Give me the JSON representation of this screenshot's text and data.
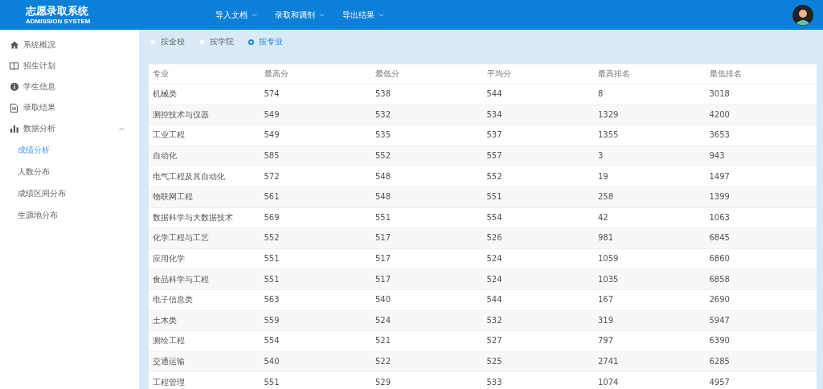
{
  "header": {
    "title": "志愿录取系统",
    "subtitle": "ADMISSION SYSTEM",
    "menu": [
      {
        "label": "导入文档"
      },
      {
        "label": "录取和调剂"
      },
      {
        "label": "导出结果"
      }
    ]
  },
  "sidebar": {
    "items": [
      {
        "label": "系统概况",
        "kind": "home",
        "selected": false
      },
      {
        "label": "招生计划",
        "kind": "book",
        "selected": false
      },
      {
        "label": "学生信息",
        "kind": "info",
        "selected": false
      },
      {
        "label": "录取结果",
        "kind": "doc",
        "selected": false
      },
      {
        "label": "数据分析",
        "kind": "chart",
        "selected": false,
        "expanded": true,
        "children": [
          {
            "label": "成绩分析",
            "selected": true
          },
          {
            "label": "人数分布",
            "selected": false
          },
          {
            "label": "成绩区间分布",
            "selected": false
          },
          {
            "label": "生源地分布",
            "selected": false
          }
        ]
      }
    ]
  },
  "filters": [
    {
      "label": "按全校",
      "selected": false
    },
    {
      "label": "按学院",
      "selected": false
    },
    {
      "label": "按专业",
      "selected": true
    }
  ],
  "table": {
    "columns": [
      "专业",
      "最高分",
      "最低分",
      "平均分",
      "最高排名",
      "最低排名"
    ],
    "rows": [
      [
        "机械类",
        "574",
        "538",
        "544",
        "8",
        "3018"
      ],
      [
        "测控技术与仪器",
        "549",
        "532",
        "534",
        "1329",
        "4200"
      ],
      [
        "工业工程",
        "549",
        "535",
        "537",
        "1355",
        "3653"
      ],
      [
        "自动化",
        "585",
        "552",
        "557",
        "3",
        "943"
      ],
      [
        "电气工程及其自动化",
        "572",
        "548",
        "552",
        "19",
        "1497"
      ],
      [
        "物联网工程",
        "561",
        "548",
        "551",
        "258",
        "1399"
      ],
      [
        "数据科学与大数据技术",
        "569",
        "551",
        "554",
        "42",
        "1063"
      ],
      [
        "化学工程与工艺",
        "552",
        "517",
        "526",
        "981",
        "6845"
      ],
      [
        "应用化学",
        "551",
        "517",
        "524",
        "1059",
        "6860"
      ],
      [
        "食品科学与工程",
        "551",
        "517",
        "524",
        "1035",
        "6858"
      ],
      [
        "电子信息类",
        "563",
        "540",
        "544",
        "167",
        "2690"
      ],
      [
        "土木类",
        "559",
        "524",
        "532",
        "319",
        "5947"
      ],
      [
        "测绘工程",
        "554",
        "521",
        "527",
        "797",
        "6390"
      ],
      [
        "交通运输",
        "540",
        "522",
        "525",
        "2741",
        "6285"
      ],
      [
        "工程管理",
        "551",
        "529",
        "533",
        "1074",
        "4957"
      ]
    ]
  }
}
